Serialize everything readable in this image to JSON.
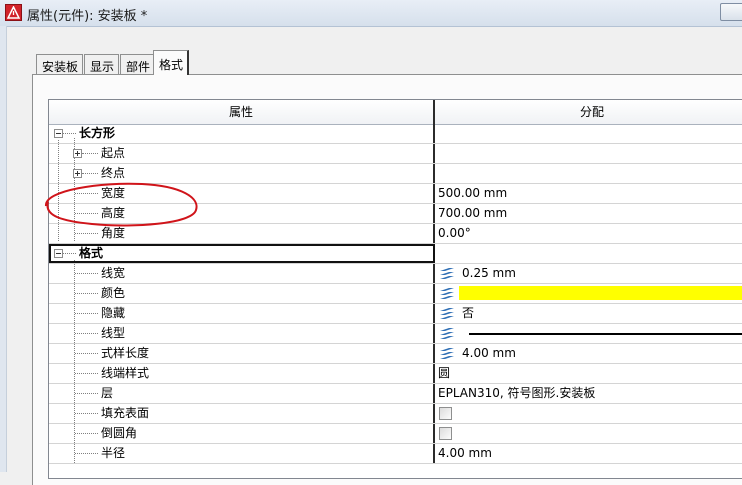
{
  "window": {
    "title": "属性(元件): 安装板 *"
  },
  "tabs": [
    {
      "label": "安装板",
      "active": false
    },
    {
      "label": "显示",
      "active": false
    },
    {
      "label": "部件",
      "active": false
    },
    {
      "label": "格式",
      "active": true
    }
  ],
  "table": {
    "columns": {
      "property": "属性",
      "value": "分配"
    },
    "rows": [
      {
        "label": "长方形",
        "value": "",
        "kind": "group"
      },
      {
        "label": "起点",
        "value": "",
        "kind": "collapsed"
      },
      {
        "label": "终点",
        "value": "",
        "kind": "collapsed"
      },
      {
        "label": "宽度",
        "value": "500.00 mm"
      },
      {
        "label": "高度",
        "value": "700.00 mm"
      },
      {
        "label": "角度",
        "value": "0.00°"
      },
      {
        "label": "格式",
        "value": "",
        "kind": "group"
      },
      {
        "label": "线宽",
        "value": "0.25 mm",
        "icon": "layer-stack-icon"
      },
      {
        "label": "颜色",
        "value": "",
        "icon": "layer-stack-icon",
        "color": "#ffff00"
      },
      {
        "label": "隐藏",
        "value": "否",
        "icon": "layer-stack-icon"
      },
      {
        "label": "线型",
        "value": "",
        "icon": "layer-stack-icon",
        "linetype": "solid"
      },
      {
        "label": "式样长度",
        "value": "4.00 mm",
        "icon": "layer-stack-icon"
      },
      {
        "label": "线端样式",
        "value": "圆"
      },
      {
        "label": "层",
        "value": "EPLAN310, 符号图形.安装板"
      },
      {
        "label": "填充表面",
        "value": "",
        "checked": false
      },
      {
        "label": "倒圆角",
        "value": "",
        "checked": false
      },
      {
        "label": "半径",
        "value": "4.00 mm"
      }
    ]
  },
  "annotation_color": "#d0141a"
}
